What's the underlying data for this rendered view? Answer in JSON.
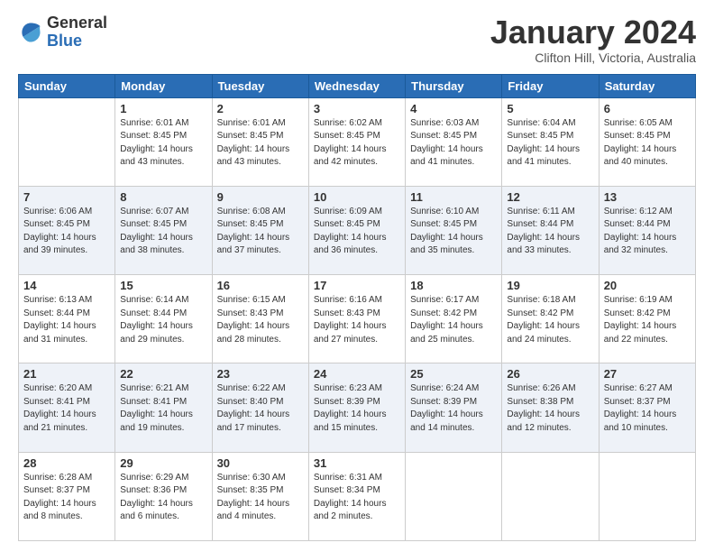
{
  "logo": {
    "general": "General",
    "blue": "Blue"
  },
  "header": {
    "month": "January 2024",
    "location": "Clifton Hill, Victoria, Australia"
  },
  "weekdays": [
    "Sunday",
    "Monday",
    "Tuesday",
    "Wednesday",
    "Thursday",
    "Friday",
    "Saturday"
  ],
  "weeks": [
    [
      {
        "day": "",
        "sunrise": "",
        "sunset": "",
        "daylight": ""
      },
      {
        "day": "1",
        "sunrise": "Sunrise: 6:01 AM",
        "sunset": "Sunset: 8:45 PM",
        "daylight": "Daylight: 14 hours and 43 minutes."
      },
      {
        "day": "2",
        "sunrise": "Sunrise: 6:01 AM",
        "sunset": "Sunset: 8:45 PM",
        "daylight": "Daylight: 14 hours and 43 minutes."
      },
      {
        "day": "3",
        "sunrise": "Sunrise: 6:02 AM",
        "sunset": "Sunset: 8:45 PM",
        "daylight": "Daylight: 14 hours and 42 minutes."
      },
      {
        "day": "4",
        "sunrise": "Sunrise: 6:03 AM",
        "sunset": "Sunset: 8:45 PM",
        "daylight": "Daylight: 14 hours and 41 minutes."
      },
      {
        "day": "5",
        "sunrise": "Sunrise: 6:04 AM",
        "sunset": "Sunset: 8:45 PM",
        "daylight": "Daylight: 14 hours and 41 minutes."
      },
      {
        "day": "6",
        "sunrise": "Sunrise: 6:05 AM",
        "sunset": "Sunset: 8:45 PM",
        "daylight": "Daylight: 14 hours and 40 minutes."
      }
    ],
    [
      {
        "day": "7",
        "sunrise": "Sunrise: 6:06 AM",
        "sunset": "Sunset: 8:45 PM",
        "daylight": "Daylight: 14 hours and 39 minutes."
      },
      {
        "day": "8",
        "sunrise": "Sunrise: 6:07 AM",
        "sunset": "Sunset: 8:45 PM",
        "daylight": "Daylight: 14 hours and 38 minutes."
      },
      {
        "day": "9",
        "sunrise": "Sunrise: 6:08 AM",
        "sunset": "Sunset: 8:45 PM",
        "daylight": "Daylight: 14 hours and 37 minutes."
      },
      {
        "day": "10",
        "sunrise": "Sunrise: 6:09 AM",
        "sunset": "Sunset: 8:45 PM",
        "daylight": "Daylight: 14 hours and 36 minutes."
      },
      {
        "day": "11",
        "sunrise": "Sunrise: 6:10 AM",
        "sunset": "Sunset: 8:45 PM",
        "daylight": "Daylight: 14 hours and 35 minutes."
      },
      {
        "day": "12",
        "sunrise": "Sunrise: 6:11 AM",
        "sunset": "Sunset: 8:44 PM",
        "daylight": "Daylight: 14 hours and 33 minutes."
      },
      {
        "day": "13",
        "sunrise": "Sunrise: 6:12 AM",
        "sunset": "Sunset: 8:44 PM",
        "daylight": "Daylight: 14 hours and 32 minutes."
      }
    ],
    [
      {
        "day": "14",
        "sunrise": "Sunrise: 6:13 AM",
        "sunset": "Sunset: 8:44 PM",
        "daylight": "Daylight: 14 hours and 31 minutes."
      },
      {
        "day": "15",
        "sunrise": "Sunrise: 6:14 AM",
        "sunset": "Sunset: 8:44 PM",
        "daylight": "Daylight: 14 hours and 29 minutes."
      },
      {
        "day": "16",
        "sunrise": "Sunrise: 6:15 AM",
        "sunset": "Sunset: 8:43 PM",
        "daylight": "Daylight: 14 hours and 28 minutes."
      },
      {
        "day": "17",
        "sunrise": "Sunrise: 6:16 AM",
        "sunset": "Sunset: 8:43 PM",
        "daylight": "Daylight: 14 hours and 27 minutes."
      },
      {
        "day": "18",
        "sunrise": "Sunrise: 6:17 AM",
        "sunset": "Sunset: 8:42 PM",
        "daylight": "Daylight: 14 hours and 25 minutes."
      },
      {
        "day": "19",
        "sunrise": "Sunrise: 6:18 AM",
        "sunset": "Sunset: 8:42 PM",
        "daylight": "Daylight: 14 hours and 24 minutes."
      },
      {
        "day": "20",
        "sunrise": "Sunrise: 6:19 AM",
        "sunset": "Sunset: 8:42 PM",
        "daylight": "Daylight: 14 hours and 22 minutes."
      }
    ],
    [
      {
        "day": "21",
        "sunrise": "Sunrise: 6:20 AM",
        "sunset": "Sunset: 8:41 PM",
        "daylight": "Daylight: 14 hours and 21 minutes."
      },
      {
        "day": "22",
        "sunrise": "Sunrise: 6:21 AM",
        "sunset": "Sunset: 8:41 PM",
        "daylight": "Daylight: 14 hours and 19 minutes."
      },
      {
        "day": "23",
        "sunrise": "Sunrise: 6:22 AM",
        "sunset": "Sunset: 8:40 PM",
        "daylight": "Daylight: 14 hours and 17 minutes."
      },
      {
        "day": "24",
        "sunrise": "Sunrise: 6:23 AM",
        "sunset": "Sunset: 8:39 PM",
        "daylight": "Daylight: 14 hours and 15 minutes."
      },
      {
        "day": "25",
        "sunrise": "Sunrise: 6:24 AM",
        "sunset": "Sunset: 8:39 PM",
        "daylight": "Daylight: 14 hours and 14 minutes."
      },
      {
        "day": "26",
        "sunrise": "Sunrise: 6:26 AM",
        "sunset": "Sunset: 8:38 PM",
        "daylight": "Daylight: 14 hours and 12 minutes."
      },
      {
        "day": "27",
        "sunrise": "Sunrise: 6:27 AM",
        "sunset": "Sunset: 8:37 PM",
        "daylight": "Daylight: 14 hours and 10 minutes."
      }
    ],
    [
      {
        "day": "28",
        "sunrise": "Sunrise: 6:28 AM",
        "sunset": "Sunset: 8:37 PM",
        "daylight": "Daylight: 14 hours and 8 minutes."
      },
      {
        "day": "29",
        "sunrise": "Sunrise: 6:29 AM",
        "sunset": "Sunset: 8:36 PM",
        "daylight": "Daylight: 14 hours and 6 minutes."
      },
      {
        "day": "30",
        "sunrise": "Sunrise: 6:30 AM",
        "sunset": "Sunset: 8:35 PM",
        "daylight": "Daylight: 14 hours and 4 minutes."
      },
      {
        "day": "31",
        "sunrise": "Sunrise: 6:31 AM",
        "sunset": "Sunset: 8:34 PM",
        "daylight": "Daylight: 14 hours and 2 minutes."
      },
      {
        "day": "",
        "sunrise": "",
        "sunset": "",
        "daylight": ""
      },
      {
        "day": "",
        "sunrise": "",
        "sunset": "",
        "daylight": ""
      },
      {
        "day": "",
        "sunrise": "",
        "sunset": "",
        "daylight": ""
      }
    ]
  ]
}
